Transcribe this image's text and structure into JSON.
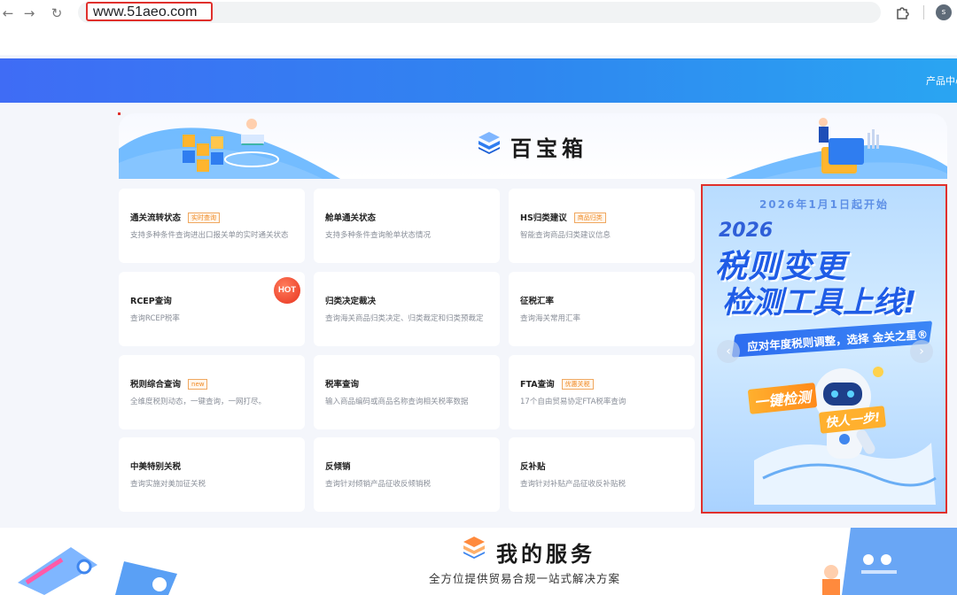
{
  "browser": {
    "url": "www.51aeo.com",
    "back_icon": "arrow-left-icon",
    "forward_icon": "arrow-right-icon",
    "reload_icon": "reload-icon",
    "extension_icon": "puzzle-icon",
    "profile_initial": "s"
  },
  "header": {
    "nav_link": "产品中心",
    "gradient_colors": [
      "#3f6cf5",
      "#2aa5f2"
    ]
  },
  "toolbox": {
    "title": "百宝箱",
    "cards": [
      {
        "title": "通关流转状态",
        "tag": "实时查询",
        "desc": "支持多种条件查询进出口报关单的实时通关状态"
      },
      {
        "title": "舱单通关状态",
        "tag": "",
        "desc": "支持多种条件查询舱单状态情况"
      },
      {
        "title": "HS归类建议",
        "tag": "商品归类",
        "desc": "智能查询商品归类建议信息"
      },
      {
        "title": "RCEP查询",
        "tag": "",
        "desc": "查询RCEP税率"
      },
      {
        "title": "归类决定裁决",
        "tag": "",
        "desc": "查询海关商品归类决定、归类裁定和归类预裁定"
      },
      {
        "title": "征税汇率",
        "tag": "",
        "desc": "查询海关常用汇率"
      },
      {
        "title": "税则综合查询",
        "tag": "new",
        "desc": "全维度税则动态，一键查询，一网打尽。"
      },
      {
        "title": "税率查询",
        "tag": "",
        "desc": "输入商品编码或商品名称查询相关税率数据"
      },
      {
        "title": "FTA查询",
        "tag": "优惠关税",
        "desc": "17个自由贸易协定FTA税率查询"
      },
      {
        "title": "中美特别关税",
        "tag": "",
        "desc": "查询实施对美加征关税"
      },
      {
        "title": "反倾销",
        "tag": "",
        "desc": "查询针对倾销产品征收反倾销税"
      },
      {
        "title": "反补贴",
        "tag": "",
        "desc": "查询针对补贴产品征收反补贴税"
      }
    ],
    "hot_badge": "HOT"
  },
  "ad": {
    "top_line": "2026年1月1日起开始",
    "year": "2026",
    "line1": "税则变更",
    "line2": "检测工具上线!",
    "ribbon": "应对年度税则调整，选择 金关之星®",
    "badge1": "一键检测",
    "badge2": "快人一步!",
    "prev_icon": "chevron-left-icon",
    "next_icon": "chevron-right-icon"
  },
  "services": {
    "title": "我的服务",
    "subtitle": "全方位提供贸易合规一站式解决方案"
  },
  "colors": {
    "highlight_border": "#e0302c",
    "tag_orange": "#f08a24",
    "brand_blue": "#2f86f0"
  }
}
